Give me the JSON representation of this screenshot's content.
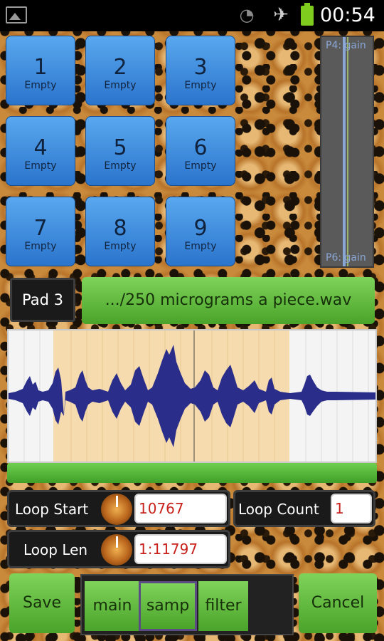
{
  "status_bar": {
    "time": "00:54",
    "icons": [
      "gallery-icon",
      "wifi-icon",
      "airplane-icon",
      "battery-icon"
    ]
  },
  "pads": [
    {
      "number": "1",
      "label": "Empty"
    },
    {
      "number": "2",
      "label": "Empty"
    },
    {
      "number": "3",
      "label": "Empty"
    },
    {
      "number": "4",
      "label": "Empty"
    },
    {
      "number": "5",
      "label": "Empty"
    },
    {
      "number": "6",
      "label": "Empty"
    },
    {
      "number": "7",
      "label": "Empty"
    },
    {
      "number": "8",
      "label": "Empty"
    },
    {
      "number": "9",
      "label": "Empty"
    }
  ],
  "meter": {
    "top_label": "P4: gain",
    "bottom_label": "P6: gain"
  },
  "selected_pad": {
    "label": "Pad 3"
  },
  "file": {
    "name": ".../250 micrograms a piece.wav"
  },
  "loop": {
    "start_label": "Loop Start",
    "start_value": "10767",
    "count_label": "Loop Count",
    "count_value": "1",
    "len_label": "Loop Len",
    "len_value": "1:11797"
  },
  "bottom": {
    "save_label": "Save",
    "cancel_label": "Cancel",
    "tabs": [
      {
        "label": "main"
      },
      {
        "label": "samp"
      },
      {
        "label": "filter"
      }
    ]
  },
  "colors": {
    "pad_blue": "#3f8ee0",
    "button_green": "#5cb838",
    "wave_blue": "#2a2e8a",
    "loop_region": "#f6d8a6",
    "field_text_red": "#c8221c"
  }
}
